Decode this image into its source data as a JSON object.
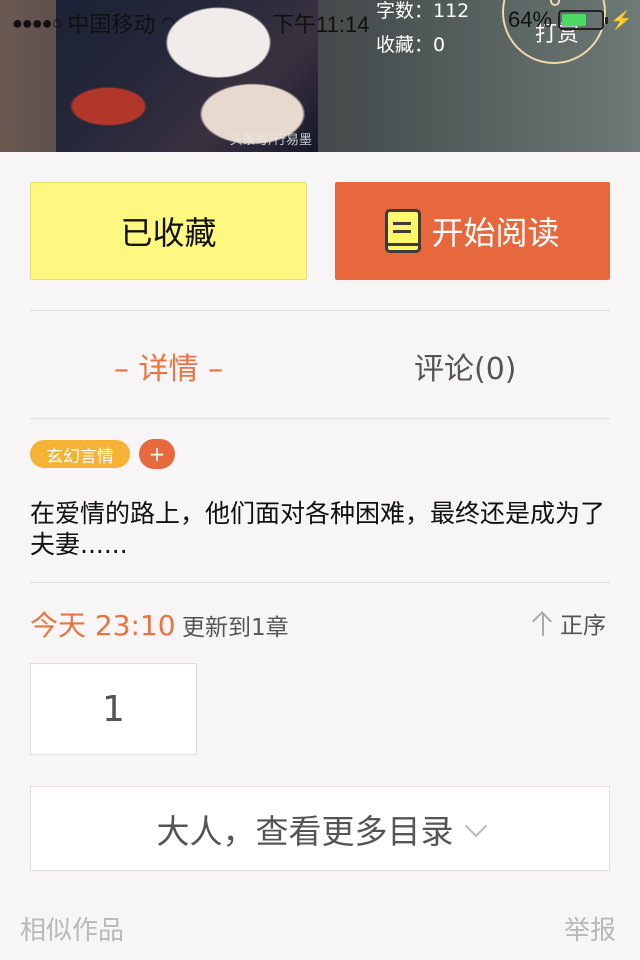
{
  "status_bar": {
    "signal_dots": "●●●●○",
    "carrier": "中国移动",
    "time": "下午11:14",
    "battery_percent": "64%",
    "battery_level": 0.64
  },
  "header": {
    "stats": {
      "word_count": "字数：112",
      "favorites": "收藏：0"
    },
    "tip_label": "打赏",
    "cover_watermark": "头条号/行易墨"
  },
  "actions": {
    "favorite_label": "已收藏",
    "read_label": "开始阅读"
  },
  "tabs": {
    "detail": "– 详情 –",
    "comments": "评论(0)"
  },
  "tags": {
    "genre": "玄幻言情",
    "add": "+"
  },
  "synopsis": "在爱情的路上，他们面对各种困难，最终还是成为了夫妻......",
  "update": {
    "time": "今天 23:10",
    "text": "更新到1章",
    "sort_label": "正序"
  },
  "chapters": [
    "1"
  ],
  "more_catalog": "大人，查看更多目录",
  "footer": {
    "similar": "相似作品",
    "report": "举报"
  },
  "colors": {
    "accent": "#e8683d",
    "favorite_bg": "#fff880",
    "tag": "#f5b234",
    "battery_fill": "#4cd964"
  }
}
